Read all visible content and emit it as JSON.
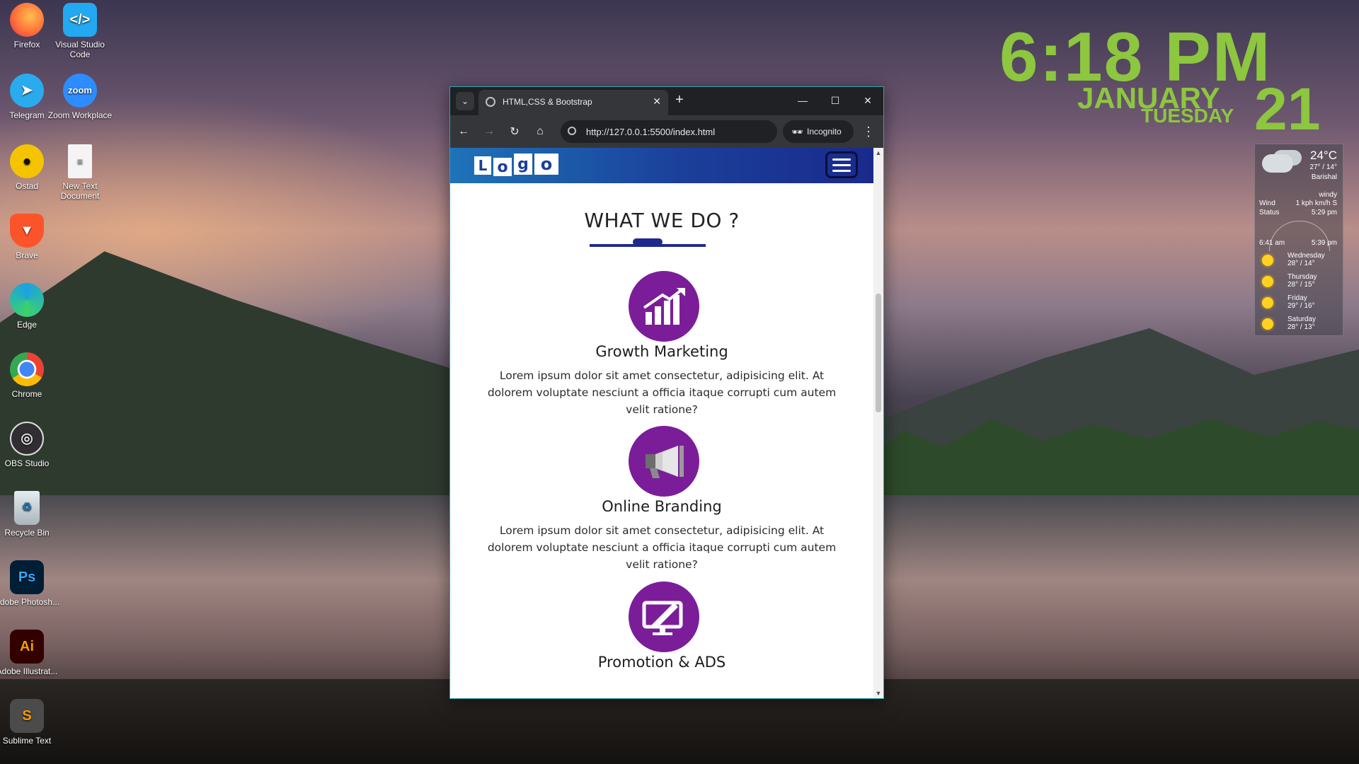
{
  "desktop": {
    "icons": [
      {
        "label": "Firefox",
        "color": "#ff7139"
      },
      {
        "label": "Visual Studio Code",
        "color": "#23a9f2"
      },
      {
        "label": "Telegram",
        "color": "#2aabee"
      },
      {
        "label": "Zoom Workplace",
        "color": "#2d8cff",
        "glyph": "zoom"
      },
      {
        "label": "Ostad",
        "color": "#f5c400"
      },
      {
        "label": "New Text Document",
        "color": "#f0f0f0"
      },
      {
        "label": "Brave",
        "color": "#fb542b"
      },
      {
        "label": "Edge",
        "color": "#1ba1e2"
      },
      {
        "label": "Chrome",
        "color": "#4285f4"
      },
      {
        "label": "OBS Studio",
        "color": "#302e31"
      },
      {
        "label": "Recycle Bin",
        "color": "#cfd8dc"
      },
      {
        "label": "Adobe Photosh...",
        "color": "#001e36",
        "glyph": "Ps"
      },
      {
        "label": "Adobe Illustrat...",
        "color": "#330000",
        "glyph": "Ai"
      },
      {
        "label": "Sublime Text",
        "color": "#4b4b4b",
        "glyph": "S"
      }
    ]
  },
  "clock": {
    "time": "6:18 PM",
    "month": "JANUARY",
    "weekday": "TUESDAY",
    "day": "21",
    "color": "#8dc63f"
  },
  "weather": {
    "temp": "24°C",
    "hilo": "27° / 14°",
    "city": "Barishal",
    "condition": "windy",
    "wind_label": "Wind",
    "wind_value": "1 kph km/h S",
    "status_label": "Status",
    "status_value": "5:29 pm",
    "sunrise": "6:41 am",
    "sunset": "5:39 pm",
    "forecast": [
      {
        "day": "Wednesday",
        "temps": "28° / 14°"
      },
      {
        "day": "Thursday",
        "temps": "28° / 15°"
      },
      {
        "day": "Friday",
        "temps": "29° / 16°"
      },
      {
        "day": "Saturday",
        "temps": "28° / 13°"
      }
    ]
  },
  "browser": {
    "tab_title": "HTML,CSS & Bootstrap",
    "url": "http://127.0.0.1:5500/index.html",
    "incognito_label": "Incognito"
  },
  "site": {
    "logo_letters": [
      "L",
      "o",
      "g",
      "o"
    ],
    "section_title": "WHAT WE DO ?",
    "accent": "#7b1d99",
    "nav_color": "#1b3f9a",
    "services": [
      {
        "name": "Growth Marketing",
        "icon": "growth-chart-icon",
        "text": "Lorem ipsum dolor sit amet consectetur, adipisicing elit. At dolorem voluptate nesciunt a officia itaque corrupti cum autem velit ratione?"
      },
      {
        "name": "Online Branding",
        "icon": "megaphone-icon",
        "text": "Lorem ipsum dolor sit amet consectetur, adipisicing elit. At dolorem voluptate nesciunt a officia itaque corrupti cum autem velit ratione?"
      },
      {
        "name": "Promotion & ADS",
        "icon": "monitor-pen-icon",
        "text": ""
      }
    ]
  }
}
